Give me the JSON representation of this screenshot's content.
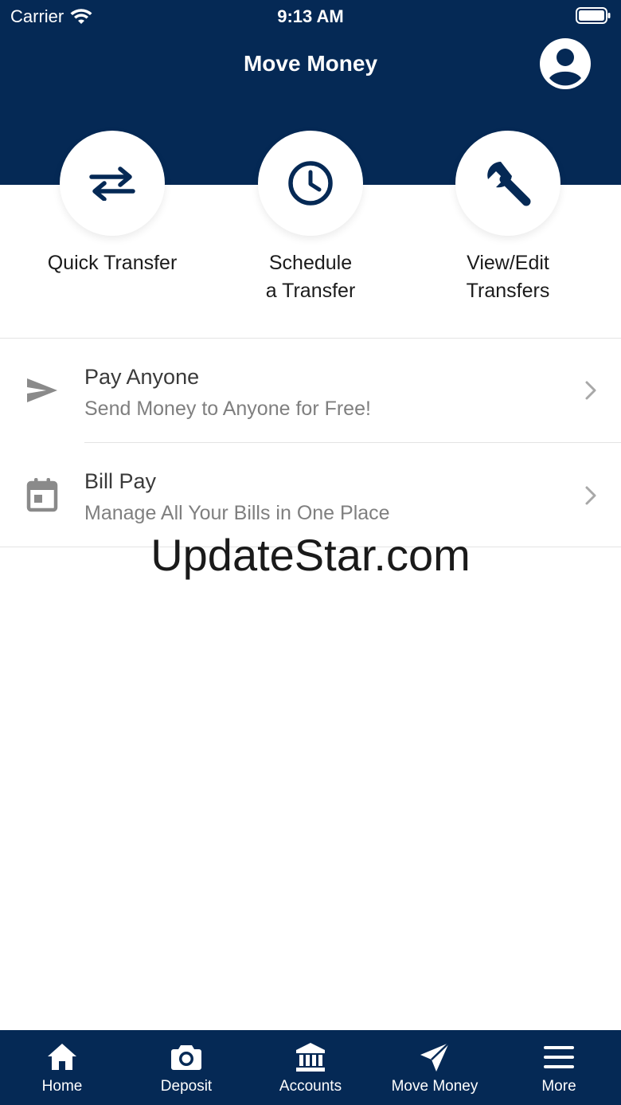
{
  "status_bar": {
    "carrier": "Carrier",
    "time": "9:13 AM"
  },
  "header": {
    "title": "Move Money"
  },
  "quick_actions": [
    {
      "label": "Quick Transfer",
      "icon": "transfer-arrows-icon"
    },
    {
      "label": "Schedule\na Transfer",
      "icon": "clock-icon"
    },
    {
      "label": "View/Edit\nTransfers",
      "icon": "wrench-icon"
    }
  ],
  "list": [
    {
      "title": "Pay Anyone",
      "subtitle": "Send Money to Anyone for Free!",
      "icon": "send-icon"
    },
    {
      "title": "Bill Pay",
      "subtitle": "Manage All Your Bills in One Place",
      "icon": "calendar-icon"
    }
  ],
  "watermark": "UpdateStar.com",
  "tabbar": {
    "items": [
      {
        "label": "Home",
        "icon": "home-icon"
      },
      {
        "label": "Deposit",
        "icon": "camera-icon"
      },
      {
        "label": "Accounts",
        "icon": "bank-icon"
      },
      {
        "label": "Move Money",
        "icon": "paper-plane-icon",
        "active": true
      },
      {
        "label": "More",
        "icon": "hamburger-menu-icon"
      }
    ]
  },
  "colors": {
    "brand_navy": "#052955",
    "text_dark": "#1b1b1b",
    "text_muted": "#7f7f7f",
    "icon_gray": "#8a8a8a"
  }
}
